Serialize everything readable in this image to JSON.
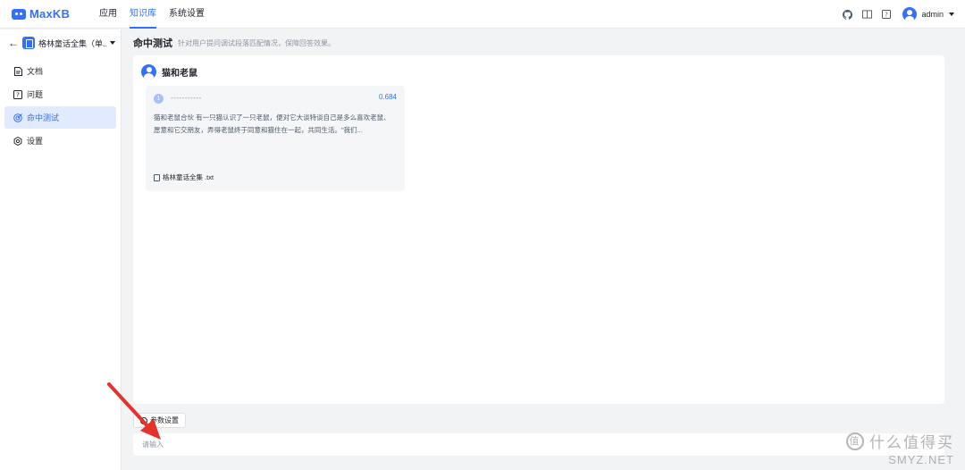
{
  "app": {
    "logo_text": "MaxKB"
  },
  "nav": {
    "items": [
      {
        "label": "应用",
        "active": false
      },
      {
        "label": "知识库",
        "active": true
      },
      {
        "label": "系统设置",
        "active": false
      }
    ]
  },
  "user": {
    "name": "admin"
  },
  "sidebar": {
    "kb_name": "格林童话全集（单...",
    "items": [
      {
        "label": "文档",
        "icon": "document-icon",
        "active": false
      },
      {
        "label": "问题",
        "icon": "question-icon",
        "active": false
      },
      {
        "label": "命中测试",
        "icon": "target-icon",
        "active": true
      },
      {
        "label": "设置",
        "icon": "gear-icon",
        "active": false
      }
    ]
  },
  "page": {
    "title": "命中测试",
    "description": "针对用户提问调试段落匹配情况，保障回答效果。"
  },
  "query": {
    "text": "猫和老鼠"
  },
  "results": [
    {
      "index": "1",
      "title": "-----------",
      "score": "0.684",
      "content": "猫和老鼠合伙 有一只猫认识了一只老鼠，便对它大谈特谈自己是多么喜欢老鼠、愿意和它交朋友，弄得老鼠终于同意和猫住在一起，共同生活。\"我们...",
      "file": "格林童话全集 .txt"
    }
  ],
  "params_button": {
    "label": "参数设置"
  },
  "input": {
    "placeholder": "请输入"
  },
  "watermark": {
    "brand": "什么值得买",
    "site": "SMYZ.NET",
    "badge": "值"
  },
  "colors": {
    "accent": "#3370ff",
    "annotation_arrow": "#e5322d"
  }
}
